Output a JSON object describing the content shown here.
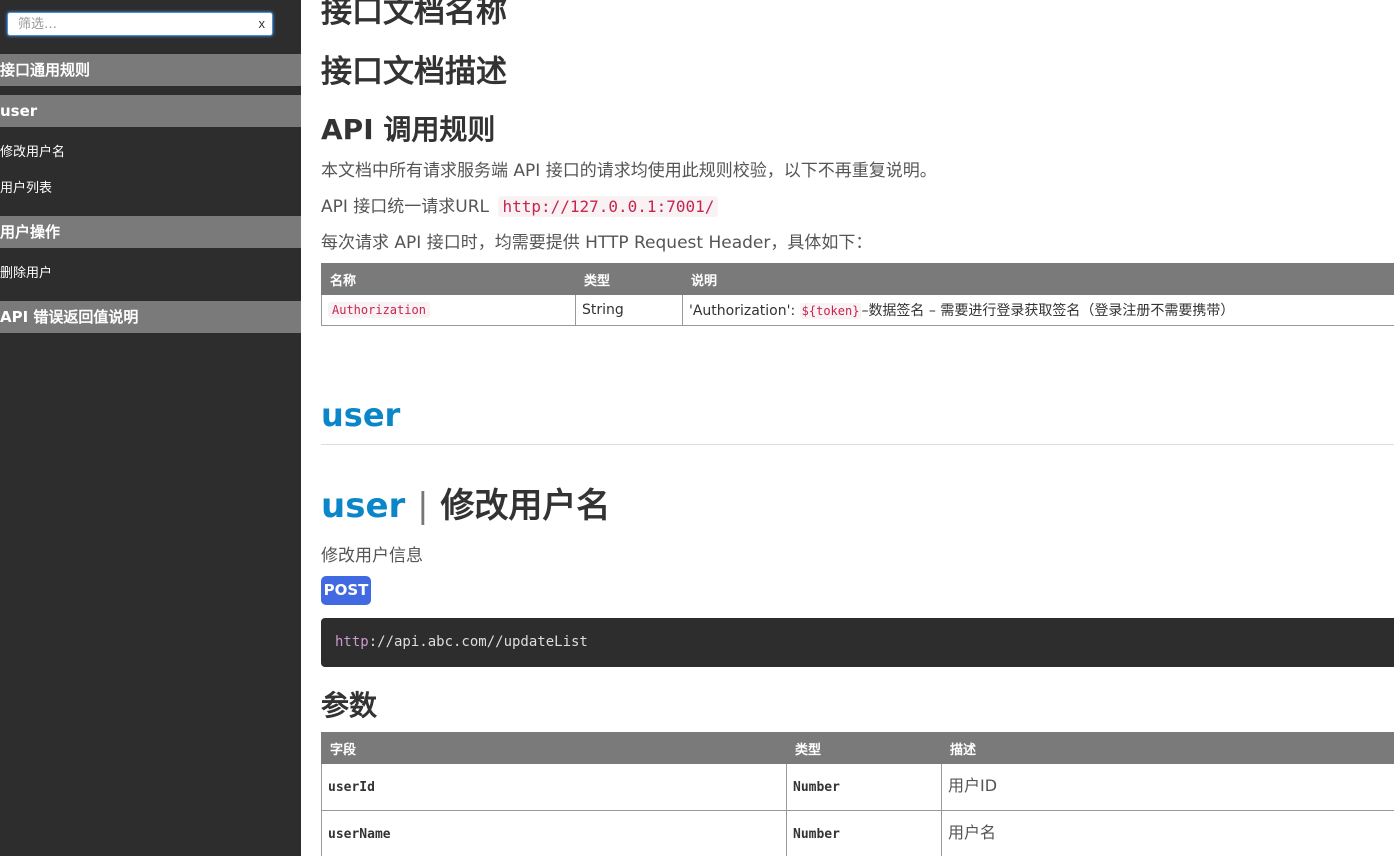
{
  "sidebar": {
    "filter_placeholder": "筛选…",
    "filter_clear": "x",
    "groups": [
      {
        "label": "接口通用规则"
      },
      {
        "label": "user",
        "items": [
          {
            "label": "修改用户名"
          },
          {
            "label": "用户列表"
          }
        ]
      },
      {
        "label": "用户操作",
        "items": [
          {
            "label": "删除用户"
          }
        ]
      },
      {
        "label": "API 错误返回值说明"
      }
    ]
  },
  "main": {
    "doc_title": "接口文档名称",
    "doc_desc": "接口文档描述",
    "rules_title": "API 调用规则",
    "rules_p1": "本文档中所有请求服务端 API 接口的请求均使用此规则校验，以下不再重复说明。",
    "rules_p2_prefix": "API 接口统一请求URL",
    "rules_p2_url": "http://127.0.0.1:7001/",
    "rules_p3": "每次请求 API 接口时，均需要提供 HTTP Request Header，具体如下：",
    "header_table": {
      "columns": [
        "名称",
        "类型",
        "说明"
      ],
      "row": {
        "name": "Authorization",
        "type": "String",
        "desc_prefix": "'Authorization': ",
        "desc_code": "${token}",
        "desc_suffix": "–数据签名 – 需要进行登录获取签名（登录注册不需要携带）"
      }
    },
    "section_user": "user",
    "api": {
      "group": "user",
      "separator": "|",
      "name": "修改用户名",
      "desc": "修改用户信息",
      "method": "POST",
      "url_proto": "http",
      "url_rest": "://api.abc.com//updateList"
    },
    "params_title": "参数",
    "params_table": {
      "columns": [
        "字段",
        "类型",
        "描述"
      ],
      "rows": [
        {
          "field": "userId",
          "type": "Number",
          "desc": "用户ID"
        },
        {
          "field": "userName",
          "type": "Number",
          "desc": "用户名"
        }
      ]
    }
  },
  "colors": {
    "sidebar_bg": "#2d2d2d",
    "nav_group_bg": "#7a7a7a",
    "user_link": "#0b87c9",
    "post_badge": "#4169e1",
    "inline_code": "#c7254e"
  }
}
